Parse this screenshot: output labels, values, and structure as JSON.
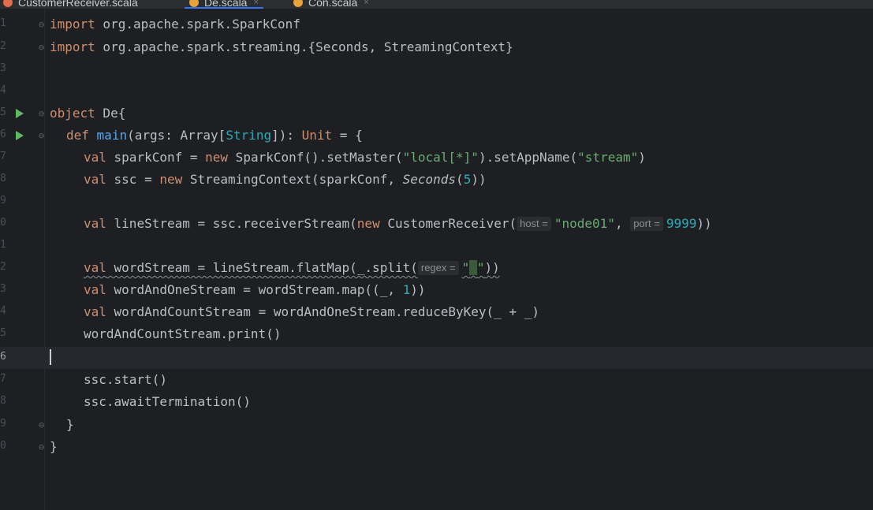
{
  "tabs": [
    {
      "label": "CustomerReceiver.scala",
      "active": false,
      "icon_color": "#e06c4c",
      "close": ""
    },
    {
      "label": "De.scala",
      "active": true,
      "icon_color": "#e8a33d",
      "close": "×"
    },
    {
      "label": "Con.scala",
      "active": false,
      "icon_color": "#e8a33d",
      "close": "×"
    }
  ],
  "line_numbers": [
    "1",
    "2",
    "3",
    "4",
    "5",
    "6",
    "7",
    "8",
    "9",
    "0",
    "1",
    "2",
    "3",
    "4",
    "5",
    "6",
    "7",
    "8",
    "9",
    "0"
  ],
  "code": {
    "l1": {
      "kw": "import",
      "rest": " org.apache.spark.SparkConf"
    },
    "l2": {
      "kw": "import",
      "a": " org.apache.spark.streaming.{Seconds",
      "b": ", StreamingContext}"
    },
    "l5": {
      "kw": "object",
      "rest": " De{"
    },
    "l6": {
      "kw": "def",
      "fn": "main",
      "a": "(args: Array[",
      "type": "String",
      "b": "]): ",
      "unit": "Unit",
      "c": " = {"
    },
    "l7": {
      "kw": "val",
      "a": " sparkConf = ",
      "kw2": "new",
      "b": " SparkConf().setMaster(",
      "s1": "\"local[*]\"",
      "c": ").setAppName(",
      "s2": "\"stream\"",
      "d": ")"
    },
    "l8": {
      "kw": "val",
      "a": " ssc = ",
      "kw2": "new",
      "b": " StreamingContext(sparkConf, ",
      "ital": "Seconds",
      "c": "(",
      "num": "5",
      "d": "))"
    },
    "l10": {
      "kw": "val",
      "a": " lineStream = ssc.receiverStream(",
      "kw2": "new",
      "b": " CustomerReceiver(",
      "hint1": "host =",
      "s1": "\"node01\"",
      "c": ", ",
      "hint2": "port =",
      "num": "9999",
      "d": "))"
    },
    "l12": {
      "kw": "val",
      "a": " wordStream = lineStream.flatMap(_.split(",
      "hint": "regex =",
      "s1": "\"",
      "space": " ",
      "s2": "\"",
      "b": "))"
    },
    "l13": {
      "kw": "val",
      "a": " wordAndOneStream = wordStream.map((_, ",
      "num": "1",
      "b": "))"
    },
    "l14": {
      "kw": "val",
      "a": " wordAndCountStream = wordAndOneStream.reduceByKey(_ + _)"
    },
    "l15": {
      "a": "wordAndCountStream.print()"
    },
    "l17": {
      "a": "ssc.start()"
    },
    "l18": {
      "a": "ssc.awaitTermination()"
    },
    "l19": {
      "a": "}"
    },
    "l20": {
      "a": "}"
    }
  },
  "colors": {
    "background": "#1e1f22",
    "keyword": "#cf8e6d",
    "function": "#56a8f5",
    "string": "#6aab73",
    "number": "#2aacb8",
    "run_icon": "#5fb865"
  }
}
